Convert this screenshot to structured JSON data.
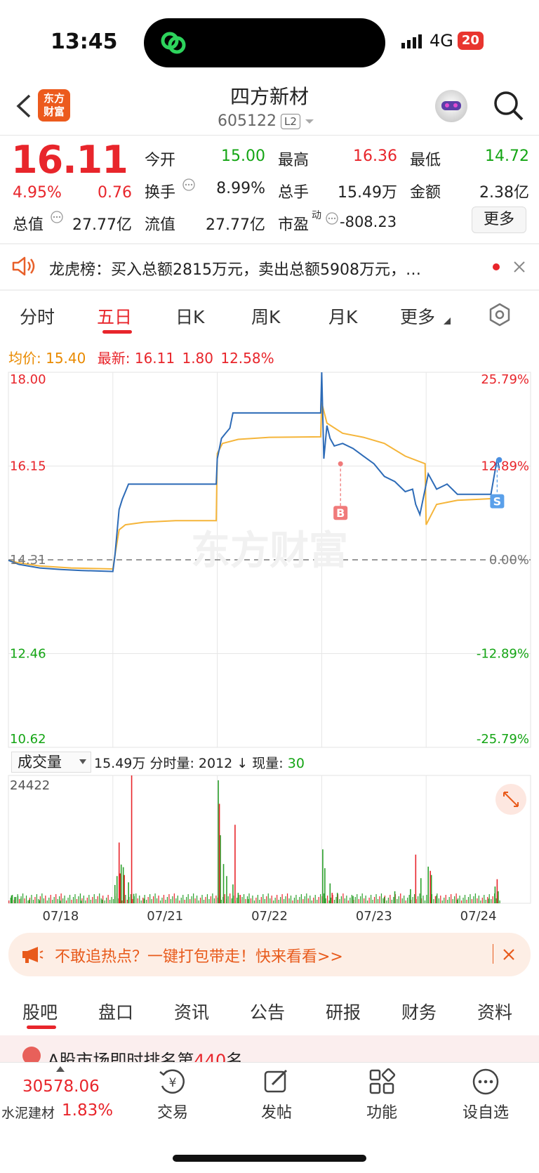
{
  "status": {
    "time": "13:45",
    "network": "4G",
    "battery": "20"
  },
  "header": {
    "logo_text_1": "东方",
    "logo_text_2": "财富",
    "name": "四方新材",
    "code": "605122",
    "l2": "L2"
  },
  "quote": {
    "price": "16.11",
    "pct": "4.95%",
    "change": "0.76",
    "open_label": "今开",
    "open": "15.00",
    "high_label": "最高",
    "high": "16.36",
    "low_label": "最低",
    "low": "14.72",
    "turnover_label": "换手",
    "turnover": "8.99%",
    "volume_label": "总手",
    "volume": "15.49万",
    "amount_label": "金额",
    "amount": "2.38亿",
    "mktcap_label": "总值",
    "mktcap": "27.77亿",
    "float_label": "流值",
    "float": "27.77亿",
    "pe_label": "市盈",
    "pe_sup": "动",
    "pe": "-808.23",
    "more": "更多"
  },
  "notice": {
    "text": "龙虎榜：买入总额2815万元，卖出总额5908万元，…"
  },
  "tabs": [
    "分时",
    "五日",
    "日K",
    "周K",
    "月K",
    "更多"
  ],
  "chart_info": {
    "avg_label": "均价:",
    "avg": "15.40",
    "latest_label": "最新:",
    "latest": "16.11",
    "latest_change": "1.80",
    "latest_pct": "12.58%"
  },
  "volume_info": {
    "selector": "成交量",
    "total": "15.49万",
    "minute_label": "分时量:",
    "minute": "2012",
    "now_label": "现量:",
    "now": "30"
  },
  "chart_data": [
    {
      "type": "line",
      "title": "",
      "x": [
        "07/18",
        "07/21",
        "07/22",
        "07/23",
        "07/24"
      ],
      "y_ticks_left": [
        "18.00",
        "16.15",
        "14.31",
        "12.46",
        "10.62"
      ],
      "y_ticks_right": [
        "25.79%",
        "12.89%",
        "0.00%",
        "-12.89%",
        "-25.79%"
      ],
      "ylim": [
        10.62,
        18.0
      ],
      "prev_close": 14.31,
      "watermark": "东方财富",
      "markers": [
        {
          "label": "B",
          "day": "07/23",
          "price": 16.2
        },
        {
          "label": "S",
          "day": "07/24",
          "price": 15.6
        }
      ],
      "series": [
        {
          "name": "",
          "color": "#2d6bb7",
          "points": [
            [
              0.0,
              14.3
            ],
            [
              0.1,
              14.22
            ],
            [
              0.3,
              14.15
            ],
            [
              0.5,
              14.12
            ],
            [
              0.7,
              14.1
            ],
            [
              1.0,
              14.08
            ],
            [
              1.02,
              14.4
            ],
            [
              1.06,
              15.3
            ],
            [
              1.09,
              15.5
            ],
            [
              1.12,
              15.65
            ],
            [
              1.15,
              15.8
            ],
            [
              1.2,
              15.8
            ],
            [
              1.4,
              15.8
            ],
            [
              1.6,
              15.8
            ],
            [
              1.99,
              15.8
            ],
            [
              2.0,
              16.3
            ],
            [
              2.04,
              16.7
            ],
            [
              2.08,
              16.8
            ],
            [
              2.12,
              16.9
            ],
            [
              2.15,
              17.2
            ],
            [
              2.3,
              17.2
            ],
            [
              2.6,
              17.2
            ],
            [
              2.99,
              17.2
            ],
            [
              3.0,
              18.0
            ],
            [
              3.02,
              16.3
            ],
            [
              3.05,
              16.95
            ],
            [
              3.08,
              16.7
            ],
            [
              3.12,
              16.55
            ],
            [
              3.2,
              16.6
            ],
            [
              3.3,
              16.5
            ],
            [
              3.4,
              16.35
            ],
            [
              3.5,
              16.2
            ],
            [
              3.6,
              15.95
            ],
            [
              3.7,
              15.85
            ],
            [
              3.8,
              15.65
            ],
            [
              3.87,
              15.7
            ],
            [
              3.9,
              15.4
            ],
            [
              3.94,
              15.2
            ],
            [
              4.02,
              16.0
            ],
            [
              4.1,
              15.7
            ],
            [
              4.2,
              15.8
            ],
            [
              4.3,
              15.6
            ],
            [
              4.4,
              15.6
            ],
            [
              4.5,
              15.6
            ],
            [
              4.62,
              15.6
            ],
            [
              4.68,
              16.3
            ],
            [
              4.7,
              16.11
            ]
          ]
        },
        {
          "name": "",
          "color": "#f5b53a",
          "points": [
            [
              0.0,
              14.3
            ],
            [
              0.1,
              14.25
            ],
            [
              0.3,
              14.19
            ],
            [
              0.6,
              14.15
            ],
            [
              1.0,
              14.13
            ],
            [
              1.02,
              14.4
            ],
            [
              1.06,
              14.9
            ],
            [
              1.12,
              15.0
            ],
            [
              1.3,
              15.05
            ],
            [
              1.6,
              15.08
            ],
            [
              1.99,
              15.08
            ],
            [
              2.0,
              16.4
            ],
            [
              2.05,
              16.6
            ],
            [
              2.2,
              16.68
            ],
            [
              2.5,
              16.72
            ],
            [
              2.99,
              16.73
            ],
            [
              3.0,
              17.4
            ],
            [
              3.05,
              17.0
            ],
            [
              3.2,
              16.8
            ],
            [
              3.4,
              16.72
            ],
            [
              3.6,
              16.6
            ],
            [
              3.8,
              16.35
            ],
            [
              3.99,
              16.2
            ],
            [
              4.0,
              15.0
            ],
            [
              4.1,
              15.4
            ],
            [
              4.3,
              15.48
            ],
            [
              4.5,
              15.5
            ],
            [
              4.7,
              15.52
            ]
          ]
        }
      ]
    },
    {
      "type": "bar",
      "title": "",
      "ylabel_top": "24422",
      "ylim": [
        0,
        24422
      ],
      "categories": [
        "07/18",
        "07/21",
        "07/22",
        "07/23",
        "07/24"
      ],
      "series": [
        {
          "name": "",
          "color": "#2ca02c",
          "bars": [
            [
              0.03,
              1500
            ],
            [
              0.06,
              1200
            ],
            [
              0.09,
              1400
            ],
            [
              0.12,
              900
            ],
            [
              0.2,
              700
            ],
            [
              0.3,
              600
            ],
            [
              0.5,
              500
            ],
            [
              0.7,
              500
            ],
            [
              0.9,
              700
            ],
            [
              1.02,
              3500
            ],
            [
              1.04,
              5200
            ],
            [
              1.08,
              7400
            ],
            [
              1.1,
              6900
            ],
            [
              1.15,
              4000
            ],
            [
              1.2,
              1800
            ],
            [
              1.3,
              900
            ],
            [
              2.01,
              23500
            ],
            [
              2.03,
              13000
            ],
            [
              2.06,
              7500
            ],
            [
              2.09,
              5200
            ],
            [
              2.15,
              3600
            ],
            [
              2.2,
              2000
            ],
            [
              2.3,
              800
            ],
            [
              3.01,
              10300
            ],
            [
              3.03,
              6700
            ],
            [
              3.08,
              3800
            ],
            [
              3.15,
              2000
            ],
            [
              3.3,
              1400
            ],
            [
              3.6,
              1200
            ],
            [
              3.7,
              2300
            ],
            [
              3.85,
              2700
            ],
            [
              3.95,
              4800
            ],
            [
              4.02,
              7000
            ],
            [
              4.05,
              5400
            ],
            [
              4.1,
              1500
            ],
            [
              4.3,
              700
            ],
            [
              4.6,
              900
            ],
            [
              4.66,
              3200
            ],
            [
              4.69,
              2300
            ]
          ]
        },
        {
          "name": "",
          "color": "#e8252b",
          "bars": [
            [
              1.06,
              11600
            ],
            [
              1.07,
              5700
            ],
            [
              1.11,
              5400
            ],
            [
              1.18,
              24422
            ],
            [
              2.02,
              19000
            ],
            [
              2.17,
              15000
            ],
            [
              2.22,
              1600
            ],
            [
              3.1,
              2000
            ],
            [
              3.9,
              9300
            ],
            [
              4.04,
              6200
            ],
            [
              4.68,
              4600
            ]
          ]
        }
      ]
    }
  ],
  "banner": {
    "text": "不敢追热点？一键打包带走！快来看看>>"
  },
  "bottom_tabs": [
    "股吧",
    "盘口",
    "资讯",
    "公告",
    "研报",
    "财务",
    "资料"
  ],
  "rank_strip": {
    "prefix": "A股市场即时排名第",
    "rank": "440",
    "suffix": "名"
  },
  "index_info": {
    "value": "30578.06",
    "name": "水泥建材",
    "pct": "1.83%"
  },
  "nav": [
    "交易",
    "发帖",
    "功能",
    "设自选"
  ]
}
